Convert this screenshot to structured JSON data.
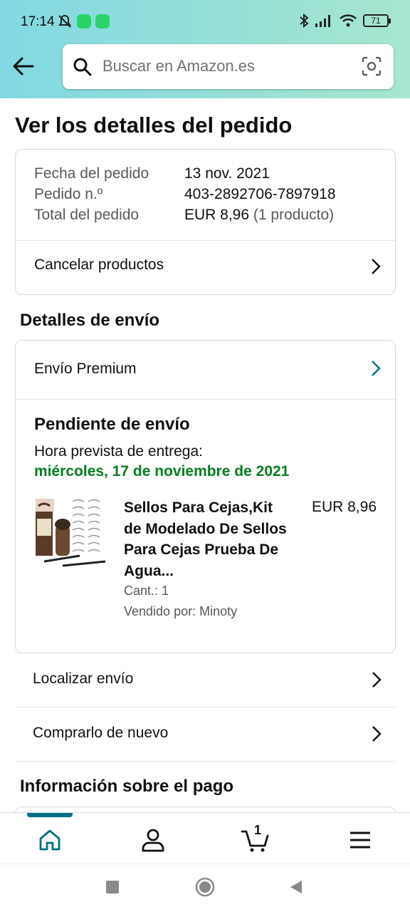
{
  "status_bar": {
    "time": "17:14",
    "battery": "71",
    "icons": [
      "muted-bell-icon",
      "whatsapp-icon",
      "app-icon",
      "bluetooth-icon",
      "signal-icon",
      "wifi-icon",
      "battery-icon"
    ]
  },
  "header": {
    "search_placeholder": "Buscar en Amazon.es"
  },
  "page": {
    "title": "Ver los detalles del pedido"
  },
  "order_summary": {
    "date_label": "Fecha del pedido",
    "date_value": "13 nov. 2021",
    "number_label": "Pedido n.º",
    "number_value": "403-2892706-7897918",
    "total_label": "Total del pedido",
    "total_value": "EUR 8,96",
    "total_items": "(1 producto)",
    "cancel_label": "Cancelar productos"
  },
  "shipping": {
    "section_title": "Detalles de envío",
    "premium_label": "Envío Premium",
    "status": "Pendiente de envío",
    "eta_label": "Hora prevista de entrega:",
    "eta_date": "miércoles, 17 de noviembre de 2021",
    "product": {
      "title": "Sellos Para Cejas,Kit de Modelado De Sellos Para Cejas Prueba De Agua...",
      "price": "EUR 8,96",
      "qty": "Cant.: 1",
      "seller": "Vendido por: Minoty"
    }
  },
  "actions": {
    "track": "Localizar envío",
    "buy_again": "Comprarlo de nuevo"
  },
  "payment": {
    "section_title": "Información sobre el pago"
  },
  "bottom_nav": {
    "cart_count": "1",
    "accent_color": "#007185"
  },
  "colors": {
    "header_gradient_start": "#82d8e3",
    "header_gradient_end": "#a6e6ce",
    "delivery_green": "#067d20"
  }
}
